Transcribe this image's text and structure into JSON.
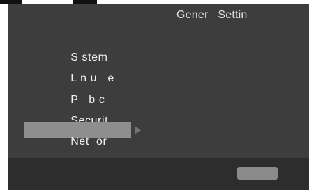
{
  "header": {
    "title": "Gener   Settin"
  },
  "menu": {
    "items": [
      {
        "label": "S stem"
      },
      {
        "label": "L n u   e"
      },
      {
        "label": "P   b c"
      },
      {
        "label": "Securit"
      },
      {
        "label": "Net  or",
        "selected": true
      }
    ],
    "selected_index": 4
  },
  "footer": {
    "button_label": ""
  },
  "colors": {
    "panel_bg": "#3d3d3d",
    "footer_bg": "#2d2d2d",
    "selection_bg": "#8e8e8e",
    "text": "#f1f1f1",
    "button_bg": "#8a8a8a"
  },
  "icons": {
    "chevron": "chevron-right-icon"
  }
}
